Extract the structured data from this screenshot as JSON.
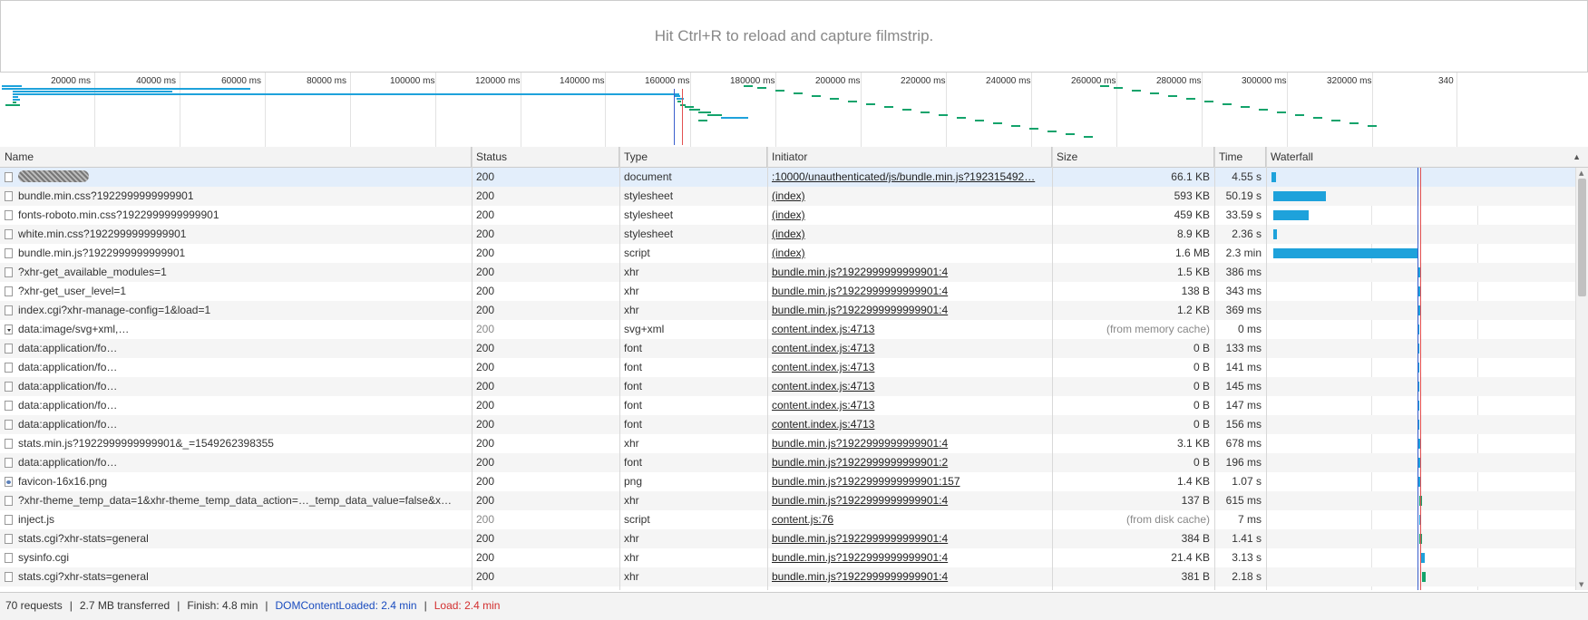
{
  "filmstrip": {
    "message": "Hit Ctrl+R to reload and capture filmstrip."
  },
  "overview": {
    "ticks": [
      "20000 ms",
      "40000 ms",
      "60000 ms",
      "80000 ms",
      "100000 ms",
      "120000 ms",
      "140000 ms",
      "160000 ms",
      "180000 ms",
      "200000 ms",
      "220000 ms",
      "240000 ms",
      "260000 ms",
      "280000 ms",
      "300000 ms",
      "320000 ms",
      "340"
    ]
  },
  "columns": {
    "name": "Name",
    "status": "Status",
    "type": "Type",
    "initiator": "Initiator",
    "size": "Size",
    "time": "Time",
    "waterfall": "Waterfall"
  },
  "rows": [
    {
      "name": "",
      "icon": "file",
      "blurred": true,
      "status": "200",
      "type": "document",
      "initiator": ":10000/unauthenticated/js/bundle.min.js?192315492…",
      "size": "66.1 KB",
      "time": "4.55 s",
      "selected": true
    },
    {
      "name": "bundle.min.css?1922999999999901",
      "icon": "file",
      "status": "200",
      "type": "stylesheet",
      "initiator": "(index)",
      "size": "593 KB",
      "time": "50.19 s"
    },
    {
      "name": "fonts-roboto.min.css?1922999999999901",
      "icon": "file",
      "status": "200",
      "type": "stylesheet",
      "initiator": "(index)",
      "size": "459 KB",
      "time": "33.59 s"
    },
    {
      "name": "white.min.css?1922999999999901",
      "icon": "file",
      "status": "200",
      "type": "stylesheet",
      "initiator": "(index)",
      "size": "8.9 KB",
      "time": "2.36 s"
    },
    {
      "name": "bundle.min.js?1922999999999901",
      "icon": "file",
      "status": "200",
      "type": "script",
      "initiator": "(index)",
      "size": "1.6 MB",
      "time": "2.3 min"
    },
    {
      "name": "?xhr-get_available_modules=1",
      "icon": "file",
      "status": "200",
      "type": "xhr",
      "initiator": "bundle.min.js?1922999999999901:4",
      "size": "1.5 KB",
      "time": "386 ms"
    },
    {
      "name": "?xhr-get_user_level=1",
      "icon": "file",
      "status": "200",
      "type": "xhr",
      "initiator": "bundle.min.js?1922999999999901:4",
      "size": "138 B",
      "time": "343 ms"
    },
    {
      "name": "index.cgi?xhr-manage-config=1&load=1",
      "icon": "file",
      "status": "200",
      "type": "xhr",
      "initiator": "bundle.min.js?1922999999999901:4",
      "size": "1.2 KB",
      "time": "369 ms"
    },
    {
      "name": "data:image/svg+xml,…",
      "icon": "svg",
      "status": "200",
      "statusMuted": true,
      "type": "svg+xml",
      "initiator": "content.index.js:4713",
      "size": "(from memory cache)",
      "sizeMuted": true,
      "time": "0 ms"
    },
    {
      "name": "data:application/fo…",
      "icon": "file",
      "status": "200",
      "type": "font",
      "initiator": "content.index.js:4713",
      "size": "0 B",
      "time": "133 ms"
    },
    {
      "name": "data:application/fo…",
      "icon": "file",
      "status": "200",
      "type": "font",
      "initiator": "content.index.js:4713",
      "size": "0 B",
      "time": "141 ms"
    },
    {
      "name": "data:application/fo…",
      "icon": "file",
      "status": "200",
      "type": "font",
      "initiator": "content.index.js:4713",
      "size": "0 B",
      "time": "145 ms"
    },
    {
      "name": "data:application/fo…",
      "icon": "file",
      "status": "200",
      "type": "font",
      "initiator": "content.index.js:4713",
      "size": "0 B",
      "time": "147 ms"
    },
    {
      "name": "data:application/fo…",
      "icon": "file",
      "status": "200",
      "type": "font",
      "initiator": "content.index.js:4713",
      "size": "0 B",
      "time": "156 ms"
    },
    {
      "name": "stats.min.js?1922999999999901&_=1549262398355",
      "icon": "file",
      "status": "200",
      "type": "xhr",
      "initiator": "bundle.min.js?1922999999999901:4",
      "size": "3.1 KB",
      "time": "678 ms"
    },
    {
      "name": "data:application/fo…",
      "icon": "file",
      "status": "200",
      "type": "font",
      "initiator": "bundle.min.js?1922999999999901:2",
      "size": "0 B",
      "time": "196 ms"
    },
    {
      "name": "favicon-16x16.png",
      "icon": "img",
      "status": "200",
      "type": "png",
      "initiator": "bundle.min.js?1922999999999901:157",
      "size": "1.4 KB",
      "time": "1.07 s"
    },
    {
      "name": "?xhr-theme_temp_data=1&xhr-theme_temp_data_action=…_temp_data_value=false&x…",
      "icon": "file",
      "status": "200",
      "type": "xhr",
      "initiator": "bundle.min.js?1922999999999901:4",
      "size": "137 B",
      "time": "615 ms"
    },
    {
      "name": "inject.js",
      "icon": "file",
      "status": "200",
      "statusMuted": true,
      "type": "script",
      "initiator": "content.js:76",
      "size": "(from disk cache)",
      "sizeMuted": true,
      "time": "7 ms"
    },
    {
      "name": "stats.cgi?xhr-stats=general",
      "icon": "file",
      "status": "200",
      "type": "xhr",
      "initiator": "bundle.min.js?1922999999999901:4",
      "size": "384 B",
      "time": "1.41 s"
    },
    {
      "name": "sysinfo.cgi",
      "icon": "file",
      "status": "200",
      "type": "xhr",
      "initiator": "bundle.min.js?1922999999999901:4",
      "size": "21.4 KB",
      "time": "3.13 s"
    },
    {
      "name": "stats.cgi?xhr-stats=general",
      "icon": "file",
      "status": "200",
      "type": "xhr",
      "initiator": "bundle.min.js?1922999999999901:4",
      "size": "381 B",
      "time": "2.18 s"
    }
  ],
  "status": {
    "requests": "70 requests",
    "transferred": "2.7 MB transferred",
    "finish": "Finish: 4.8 min",
    "dcl": "DOMContentLoaded: 2.4 min",
    "load": "Load: 2.4 min",
    "separator": "|"
  },
  "colors": {
    "selected_row": "#e3eefb",
    "waterfall_bar": "#1ea2db",
    "waterfall_green": "#13a36b",
    "dcl_line": "#3a5fcd",
    "load_line": "#e25050"
  }
}
